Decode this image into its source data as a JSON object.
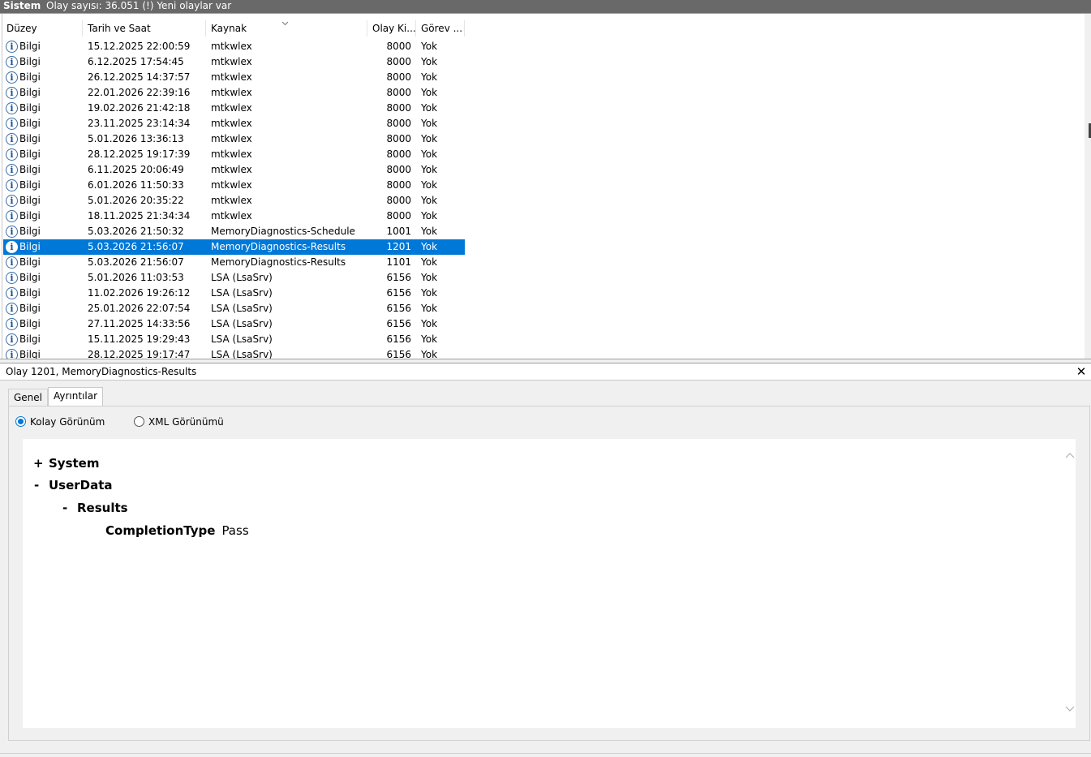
{
  "window": {
    "log_name": "Sistem",
    "status": "Olay sayısı: 36.051 (!) Yeni olaylar var"
  },
  "columns": {
    "level": "Düzey",
    "datetime": "Tarih ve Saat",
    "source": "Kaynak",
    "event_id": "Olay Ki...",
    "task": "Görev ..."
  },
  "icons": {
    "info": "info-circle-icon",
    "close": "close-icon",
    "sort": "sort-chevron-icon"
  },
  "rows": [
    {
      "level": "Bilgi",
      "datetime": "15.12.2025 22:00:59",
      "source": "mtkwlex",
      "event_id": "8000",
      "task": "Yok"
    },
    {
      "level": "Bilgi",
      "datetime": "6.12.2025 17:54:45",
      "source": "mtkwlex",
      "event_id": "8000",
      "task": "Yok"
    },
    {
      "level": "Bilgi",
      "datetime": "26.12.2025 14:37:57",
      "source": "mtkwlex",
      "event_id": "8000",
      "task": "Yok"
    },
    {
      "level": "Bilgi",
      "datetime": "22.01.2026 22:39:16",
      "source": "mtkwlex",
      "event_id": "8000",
      "task": "Yok"
    },
    {
      "level": "Bilgi",
      "datetime": "19.02.2026 21:42:18",
      "source": "mtkwlex",
      "event_id": "8000",
      "task": "Yok"
    },
    {
      "level": "Bilgi",
      "datetime": "23.11.2025 23:14:34",
      "source": "mtkwlex",
      "event_id": "8000",
      "task": "Yok"
    },
    {
      "level": "Bilgi",
      "datetime": "5.01.2026 13:36:13",
      "source": "mtkwlex",
      "event_id": "8000",
      "task": "Yok"
    },
    {
      "level": "Bilgi",
      "datetime": "28.12.2025 19:17:39",
      "source": "mtkwlex",
      "event_id": "8000",
      "task": "Yok"
    },
    {
      "level": "Bilgi",
      "datetime": "6.11.2025 20:06:49",
      "source": "mtkwlex",
      "event_id": "8000",
      "task": "Yok"
    },
    {
      "level": "Bilgi",
      "datetime": "6.01.2026 11:50:33",
      "source": "mtkwlex",
      "event_id": "8000",
      "task": "Yok"
    },
    {
      "level": "Bilgi",
      "datetime": "5.01.2026 20:35:22",
      "source": "mtkwlex",
      "event_id": "8000",
      "task": "Yok"
    },
    {
      "level": "Bilgi",
      "datetime": "18.11.2025 21:34:34",
      "source": "mtkwlex",
      "event_id": "8000",
      "task": "Yok"
    },
    {
      "level": "Bilgi",
      "datetime": "5.03.2026 21:50:32",
      "source": "MemoryDiagnostics-Schedule",
      "event_id": "1001",
      "task": "Yok"
    },
    {
      "level": "Bilgi",
      "datetime": "5.03.2026 21:56:07",
      "source": "MemoryDiagnostics-Results",
      "event_id": "1201",
      "task": "Yok",
      "selected": true
    },
    {
      "level": "Bilgi",
      "datetime": "5.03.2026 21:56:07",
      "source": "MemoryDiagnostics-Results",
      "event_id": "1101",
      "task": "Yok"
    },
    {
      "level": "Bilgi",
      "datetime": "5.01.2026 11:03:53",
      "source": "LSA (LsaSrv)",
      "event_id": "6156",
      "task": "Yok"
    },
    {
      "level": "Bilgi",
      "datetime": "11.02.2026 19:26:12",
      "source": "LSA (LsaSrv)",
      "event_id": "6156",
      "task": "Yok"
    },
    {
      "level": "Bilgi",
      "datetime": "25.01.2026 22:07:54",
      "source": "LSA (LsaSrv)",
      "event_id": "6156",
      "task": "Yok"
    },
    {
      "level": "Bilgi",
      "datetime": "27.11.2025 14:33:56",
      "source": "LSA (LsaSrv)",
      "event_id": "6156",
      "task": "Yok"
    },
    {
      "level": "Bilgi",
      "datetime": "15.11.2025 19:29:43",
      "source": "LSA (LsaSrv)",
      "event_id": "6156",
      "task": "Yok"
    },
    {
      "level": "Bilgi",
      "datetime": "28.12.2025 19:17:47",
      "source": "LSA (LsaSrv)",
      "event_id": "6156",
      "task": "Yok"
    }
  ],
  "detail": {
    "title": "Olay 1201, MemoryDiagnostics-Results",
    "close_glyph": "✕",
    "tabs": [
      {
        "label": "Genel"
      },
      {
        "label": "Ayrıntılar",
        "active": true
      }
    ],
    "view_options": [
      {
        "label": "Kolay Görünüm",
        "selected": true
      },
      {
        "label": "XML Görünümü",
        "selected": false
      }
    ],
    "tree": {
      "system": {
        "toggle": "+",
        "label": "System"
      },
      "userdata": {
        "toggle": "-",
        "label": "UserData"
      },
      "results": {
        "toggle": "-",
        "label": "Results"
      },
      "field": {
        "key": "CompletionType",
        "value": "Pass"
      }
    }
  },
  "colors": {
    "selection": "#0078d7",
    "titlebar": "#696969"
  }
}
